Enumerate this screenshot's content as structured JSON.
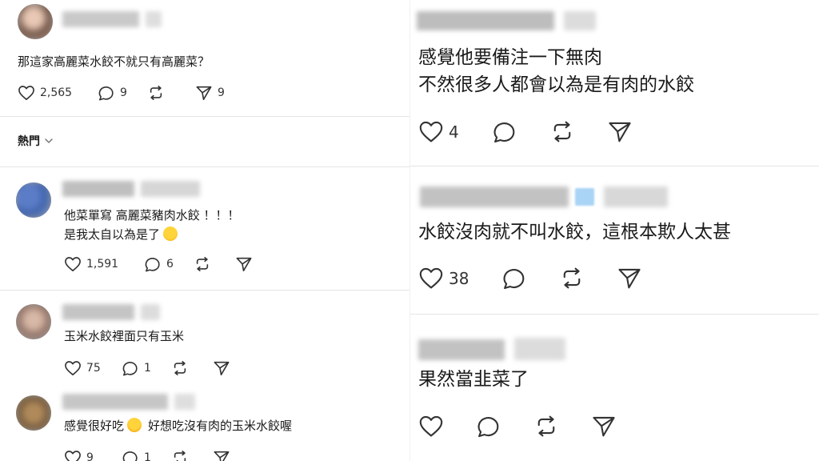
{
  "left_panel": {
    "top_post": {
      "text": "那這家高麗菜水餃不就只有高麗菜？",
      "likes": "2,565",
      "comments": "9",
      "shares": "9"
    },
    "sort_dropdown": {
      "label": "熱門"
    },
    "replies": [
      {
        "lines": [
          "他菜單寫 高麗菜豬肉水餃 ！！！",
          "是我太自以為是了"
        ],
        "emoji": "crying-face",
        "likes": "1,591",
        "comments": "6"
      },
      {
        "lines": [
          "玉米水餃裡面只有玉米"
        ],
        "likes": "75",
        "comments": "1"
      },
      {
        "lines": [
          "感覺很好吃",
          "好想吃沒有肉的玉米水餃喔"
        ],
        "emoji": "yum-face",
        "likes": "9",
        "comments": "1"
      }
    ]
  },
  "right_panel": {
    "replies": [
      {
        "lines": [
          "感覺他要備注一下無肉",
          "不然很多人都會以為是有肉的水餃"
        ],
        "likes": "4"
      },
      {
        "lines": [
          "水餃沒肉就不叫水餃，這根本欺人太甚"
        ],
        "likes": "38"
      },
      {
        "lines": [
          "果然當韭菜了"
        ],
        "likes": ""
      }
    ]
  },
  "colors": {
    "text": "#1a1a1a",
    "icon": "#333333",
    "divider": "#e5e5e5"
  }
}
